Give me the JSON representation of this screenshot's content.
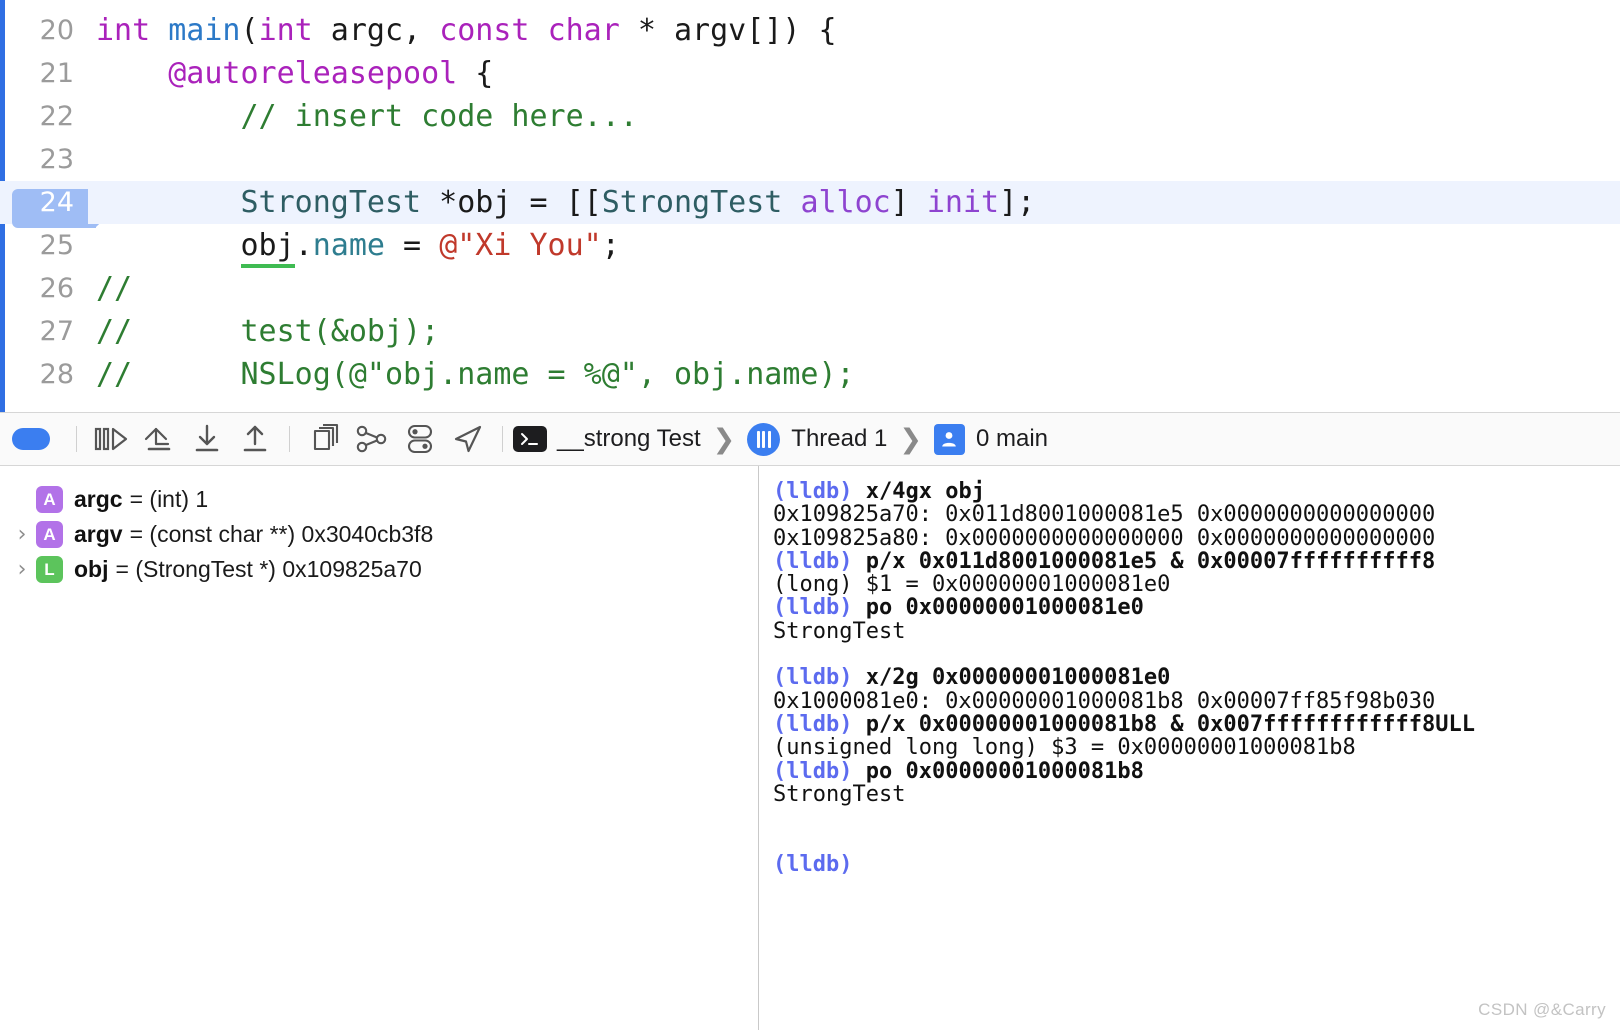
{
  "editor": {
    "current_line": 24,
    "lines": [
      {
        "number": "20",
        "tokens": [
          {
            "t": "int ",
            "c": "kw"
          },
          {
            "t": "main",
            "c": "fn"
          },
          {
            "t": "(",
            "c": "plain"
          },
          {
            "t": "int",
            "c": "kw"
          },
          {
            "t": " argc, ",
            "c": "plain"
          },
          {
            "t": "const",
            "c": "kw"
          },
          {
            "t": " ",
            "c": "plain"
          },
          {
            "t": "char",
            "c": "kw"
          },
          {
            "t": " * argv[]) {",
            "c": "plain"
          }
        ]
      },
      {
        "number": "21",
        "tokens": [
          {
            "t": "    ",
            "c": "plain"
          },
          {
            "t": "@autoreleasepool",
            "c": "kw"
          },
          {
            "t": " {",
            "c": "plain"
          }
        ]
      },
      {
        "number": "22",
        "tokens": [
          {
            "t": "        ",
            "c": "plain"
          },
          {
            "t": "// insert code here...",
            "c": "comment"
          }
        ]
      },
      {
        "number": "23",
        "tokens": [
          {
            "t": "",
            "c": "plain"
          }
        ]
      },
      {
        "number": "24",
        "tokens": [
          {
            "t": "        ",
            "c": "plain"
          },
          {
            "t": "StrongTest",
            "c": "type"
          },
          {
            "t": " *obj = [[",
            "c": "plain"
          },
          {
            "t": "StrongTest",
            "c": "type"
          },
          {
            "t": " ",
            "c": "plain"
          },
          {
            "t": "alloc",
            "c": "method"
          },
          {
            "t": "] ",
            "c": "plain"
          },
          {
            "t": "init",
            "c": "method"
          },
          {
            "t": "];",
            "c": "plain"
          }
        ]
      },
      {
        "number": "25",
        "tokens": [
          {
            "t": "        ",
            "c": "plain"
          },
          {
            "t": "obj",
            "c": "var-underline"
          },
          {
            "t": ".",
            "c": "plain"
          },
          {
            "t": "name",
            "c": "prop"
          },
          {
            "t": " = ",
            "c": "plain"
          },
          {
            "t": "@\"Xi You\"",
            "c": "str"
          },
          {
            "t": ";",
            "c": "plain"
          }
        ]
      },
      {
        "number": "26",
        "tokens": [
          {
            "t": "//",
            "c": "comment"
          }
        ]
      },
      {
        "number": "27",
        "tokens": [
          {
            "t": "//      test(&obj);",
            "c": "comment"
          }
        ]
      },
      {
        "number": "28",
        "tokens": [
          {
            "t": "//      NSLog(@\"obj.name = %@\", obj.name);",
            "c": "comment"
          }
        ]
      }
    ]
  },
  "debug_bar": {
    "buttons": [
      {
        "name": "deactivate-breakpoints-button",
        "icon": "breakpoint-pill-icon",
        "label": "Deactivate Breakpoints"
      },
      {
        "name": "continue-button",
        "icon": "continue-execution-icon",
        "label": "Continue"
      },
      {
        "name": "step-over-button",
        "icon": "step-over-icon",
        "label": "Step Over"
      },
      {
        "name": "step-into-button",
        "icon": "step-into-icon",
        "label": "Step Into"
      },
      {
        "name": "step-out-button",
        "icon": "step-out-icon",
        "label": "Step Out"
      },
      {
        "name": "debug-view-hierarchy-button",
        "icon": "view-hierarchy-icon",
        "label": "Debug View Hierarchy"
      },
      {
        "name": "debug-memory-graph-button",
        "icon": "memory-graph-icon",
        "label": "Debug Memory Graph"
      },
      {
        "name": "environment-overrides-button",
        "icon": "environment-overrides-icon",
        "label": "Environment Overrides"
      },
      {
        "name": "simulate-location-button",
        "icon": "location-arrow-icon",
        "label": "Simulate Location"
      }
    ],
    "breadcrumb": {
      "process_icon": "terminal-icon",
      "process": "__strong Test",
      "thread_icon": "thread-icon",
      "thread": "Thread 1",
      "frame_icon": "stack-frame-person-icon",
      "frame": "0 main",
      "separator": "❯"
    }
  },
  "variables": {
    "rows": [
      {
        "expandable": false,
        "badge": "A",
        "badge_kind": "argument",
        "name": "argc",
        "rest": "= (int) 1"
      },
      {
        "expandable": true,
        "badge": "A",
        "badge_kind": "argument",
        "name": "argv",
        "rest": "= (const char **) 0x3040cb3f8"
      },
      {
        "expandable": true,
        "badge": "L",
        "badge_kind": "local",
        "name": "obj",
        "rest": "= (StrongTest *) 0x109825a70"
      }
    ],
    "disclosure_glyph": "›"
  },
  "console": {
    "lines": [
      {
        "prompt": "(lldb)",
        "cmd": " x/4gx obj"
      },
      {
        "text": "0x109825a70: 0x011d8001000081e5 0x0000000000000000"
      },
      {
        "text": "0x109825a80: 0x0000000000000000 0x0000000000000000"
      },
      {
        "prompt": "(lldb)",
        "cmd": " p/x 0x011d8001000081e5 & 0x00007ffffffffff8"
      },
      {
        "text": "(long) $1 = 0x00000001000081e0"
      },
      {
        "prompt": "(lldb)",
        "cmd": " po 0x00000001000081e0"
      },
      {
        "text": "StrongTest"
      },
      {
        "text": ""
      },
      {
        "prompt": "(lldb)",
        "cmd": " x/2g 0x00000001000081e0"
      },
      {
        "text": "0x1000081e0: 0x00000001000081b8 0x00007ff85f98b030"
      },
      {
        "prompt": "(lldb)",
        "cmd": " p/x 0x00000001000081b8 & 0x007ffffffffffff8ULL"
      },
      {
        "text": "(unsigned long long) $3 = 0x00000001000081b8"
      },
      {
        "prompt": "(lldb)",
        "cmd": " po 0x00000001000081b8"
      },
      {
        "text": "StrongTest"
      },
      {
        "text": ""
      },
      {
        "text": ""
      },
      {
        "prompt": "(lldb)",
        "cmd": ""
      }
    ]
  },
  "watermark": "CSDN @&Carry",
  "colors": {
    "accent_blue": "#3b7ef0",
    "current_line_bg": "#eef3fe",
    "lineno_pill": "#9fbdf5",
    "comment_green": "#2e7d32",
    "keyword_purple": "#aa22bb",
    "string_red": "#c0392b",
    "type_teal": "#2e5d63",
    "prompt_blue": "#5c6bef"
  }
}
